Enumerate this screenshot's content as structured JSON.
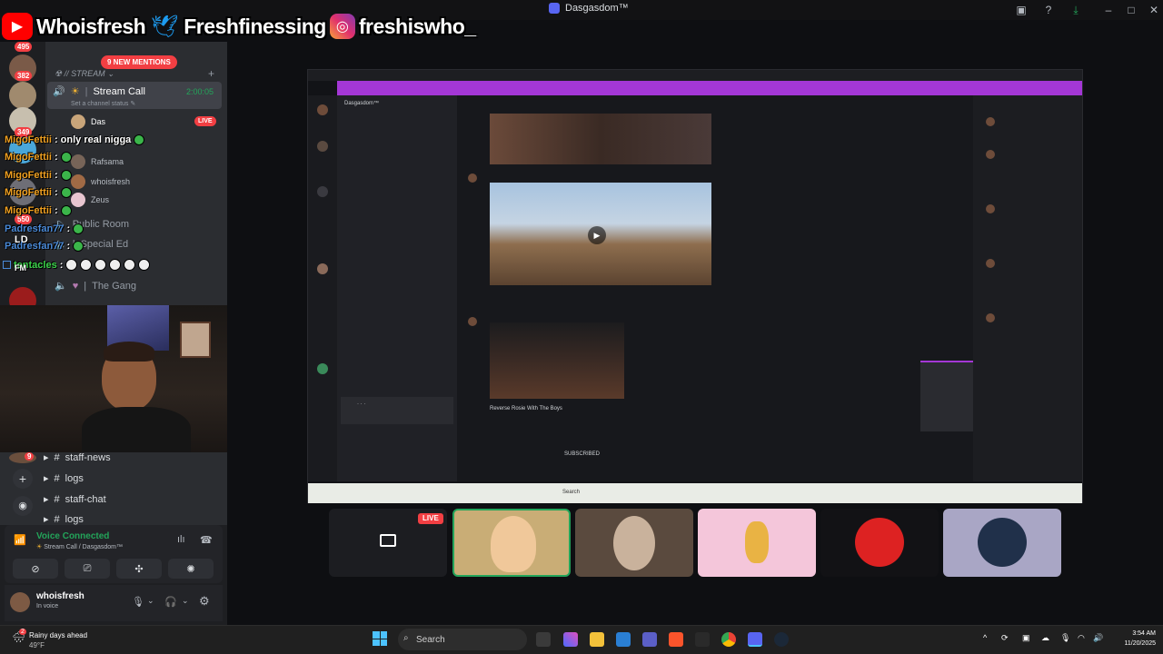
{
  "window": {
    "title": "Dasgasdom™"
  },
  "banner": {
    "youtube": "Whoisfresh",
    "twitter": "Freshfinessing",
    "instagram": "freshiswho_"
  },
  "server_badges": [
    "495",
    "382",
    "349",
    "550"
  ],
  "new_mentions": "9 NEW MENTIONS",
  "category_stream": "// STREAM",
  "stream_call": {
    "name": "Stream Call",
    "timer": "2:00:05",
    "status": "Set a channel status"
  },
  "voice_users": [
    {
      "name": "Das",
      "live": "LIVE"
    },
    {
      "name": "Rafsama"
    },
    {
      "name": "whoisfresh"
    },
    {
      "name": "Zeus"
    }
  ],
  "channels": [
    "Public Room",
    "Special Ed",
    "The Gang"
  ],
  "chat": [
    {
      "user": "MigoFettii",
      "text": ": only real nigga"
    },
    {
      "user": "MigoFettii",
      "text": ":"
    },
    {
      "user": "MigoFettii",
      "text": ":"
    },
    {
      "user": "MigoFettii",
      "text": ":"
    },
    {
      "user": "MigoFettii",
      "text": ":"
    },
    {
      "user": "Padresfan77",
      "text": ":"
    },
    {
      "user": "Padresfan77",
      "text": ":"
    },
    {
      "user": "tentacles",
      "text": ":"
    }
  ],
  "overlay_initials": [
    "LD",
    "FM"
  ],
  "bottom_channels": [
    "staff-news",
    "logs",
    "staff-chat",
    "logs"
  ],
  "bottom_badge": "9",
  "voice_connected": {
    "title": "Voice Connected",
    "subtitle": "Stream Call / Dasgasdom™"
  },
  "user": {
    "name": "whoisfresh",
    "status": "In voice"
  },
  "tiles_live": "LIVE",
  "taskbar": {
    "weather_title": "Rainy days ahead",
    "weather_temp": "49°F",
    "weather_badge": "2",
    "search": "Search",
    "time": "3:54 AM",
    "date": "11/20/2025"
  },
  "nested": {
    "server_name": "Dasgasdom™",
    "subscribed": "SUBSCRIBED",
    "video_title": "Reverse Rosie With The Boys",
    "search": "Search"
  },
  "colors": {
    "accent": "#5865f2",
    "live": "#f23f43",
    "nested_banner": "#a437d6",
    "voice_green": "#23a55a"
  }
}
